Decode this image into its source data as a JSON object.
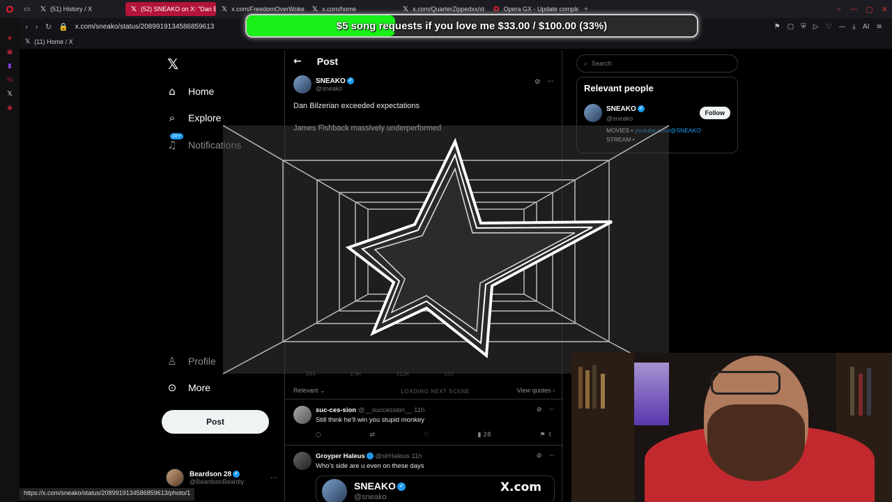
{
  "browser": {
    "tabs": [
      {
        "title": "(51) History / X",
        "active": false
      },
      {
        "title": "(52) SNEAKO on X: \"Dan B",
        "active": true
      },
      {
        "title": "x.com/FreedomOverWoke",
        "active": false
      },
      {
        "title": "x.com/home",
        "active": false
      },
      {
        "title": "x.com/QuarterZippedxx/st",
        "active": false
      },
      {
        "title": "Opera GX - Update comple",
        "active": false
      }
    ],
    "url": "x.com/sneako/status/2089919134586859613",
    "bookmark": "(11) Home / X",
    "ai_label": "AI",
    "status_url": "https://x.com/sneako/status/2089919134586859613/photo/1"
  },
  "donation": {
    "text": "$5 song requests if you love me $33.00 / $100.00 (33%)",
    "progress": 0.33,
    "color": "#19f019"
  },
  "sidebar": {
    "items": [
      {
        "label": "Home",
        "icon": "home-icon"
      },
      {
        "label": "Explore",
        "icon": "search-icon"
      },
      {
        "label": "Notifications",
        "icon": "bell-icon",
        "badge": "20+"
      },
      {
        "label": "Profile",
        "icon": "person-icon"
      },
      {
        "label": "More",
        "icon": "more-circle-icon"
      }
    ],
    "post_button": "Post",
    "account": {
      "name": "Beardson 28",
      "handle": "@BeardsonBeardly"
    }
  },
  "post": {
    "header": "Post",
    "author": "SNEAKO",
    "handle": "@sneako",
    "lines": [
      "Dan Bilzerian exceeded expectations",
      "James Fishback massively underperformed"
    ],
    "stats": [
      "244",
      "2.9K",
      "212K",
      "153"
    ],
    "sort_label": "Relevant",
    "view_quotes": "View quotes",
    "stinger_text": "LOADING NEXT SCENE"
  },
  "replies": [
    {
      "name": "suc-ces-sion",
      "handle": "@__succession__",
      "time": "11h",
      "text": "Still think he'll win you stupid monkey",
      "views": "28"
    },
    {
      "name": "Groyper Haleus",
      "handle": "@slrHaleus",
      "time": "11h",
      "text": "Who's side are u even on these days"
    }
  ],
  "quote_card": {
    "name": "SNEAKO",
    "handle": "@sneako",
    "brand": "X.com"
  },
  "right": {
    "search_placeholder": "Search",
    "relevant_title": "Relevant people",
    "person": {
      "name": "SNEAKO",
      "handle": "@sneako",
      "follow": "Follow",
      "bio_prefix": "MOVIES •",
      "bio_link": "youtube.com/@SNEAKO",
      "bio_suffix": "STREAM •"
    }
  }
}
